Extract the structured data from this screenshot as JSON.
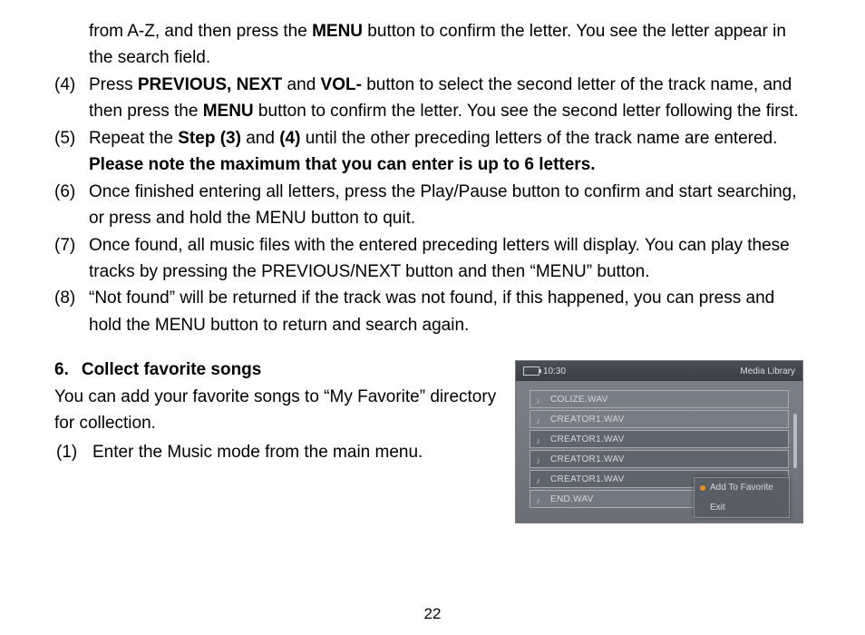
{
  "para_cont_pre": "from A-Z, and then press the ",
  "b_menu": "MENU",
  "para_cont_post": " button to confirm the letter. You see the letter appear in the search field.",
  "steps": {
    "s4": {
      "n": "(4)",
      "t1": "Press ",
      "b1": "PREVIOUS, NEXT",
      "t2": " and ",
      "b2": "VOL-",
      "t3": " button to select the second letter of the track name, and then press the ",
      "b3": "MENU",
      "t4": " button to confirm the letter. You see the second letter following the first."
    },
    "s5": {
      "n": "(5)",
      "t1": "Repeat the ",
      "b1": "Step (3)",
      "t2": " and ",
      "b2": "(4)",
      "t3": " until the other preceding letters of the track name are entered. ",
      "b3": "Please note the maximum that you can enter is up to 6 letters."
    },
    "s6": {
      "n": "(6)",
      "t": "Once finished entering all letters, press the Play/Pause button to confirm and start searching, or press and hold the MENU button to quit."
    },
    "s7": {
      "n": "(7)",
      "t": "Once found, all music files with the entered preceding letters will display. You can play these tracks by pressing the PREVIOUS/NEXT button and then “MENU” button."
    },
    "s8": {
      "n": "(8)",
      "t": "“Not found” will be returned if the track was not found, if this happened, you can press and hold the MENU button to return and search again."
    }
  },
  "section": {
    "num": "6.",
    "title": "Collect favorite songs",
    "body": "You can add your favorite songs to “My Favorite” directory for collection.",
    "sub1_n": "(1)",
    "sub1_t": "Enter the Music mode from the main menu."
  },
  "screenshot": {
    "time": "10:30",
    "header_right": "Media Library",
    "files": [
      "COLIZE.WAV",
      "CREATOR1.WAV",
      "CREATOR1.WAV",
      "CREATOR1.WAV",
      "CREATOR1.WAV",
      "END.WAV"
    ],
    "popup": {
      "opt1": "Add To Favorite",
      "opt2": "Exit"
    }
  },
  "page_number": "22"
}
